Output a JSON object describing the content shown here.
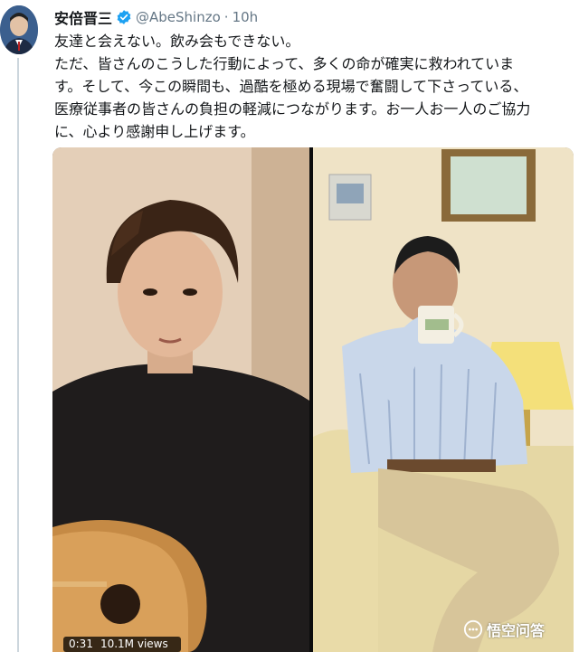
{
  "tweet": {
    "author_name": "安倍晋三",
    "handle": "@AbeShinzo",
    "separator": "·",
    "time": "10h",
    "lines": [
      "友達と会えない。飲み会もできない。",
      "ただ、皆さんのこうした行動によって、多くの命が確実に救われていま",
      "す。そして、今この瞬間も、過酷を極める現場で奮闘して下さっている、",
      "医療従事者の皆さんの負担の軽減につながります。お一人お一人のご協力",
      "に、心より感謝申し上げます。"
    ]
  },
  "media": {
    "duration": "0:31",
    "views": "10.1M views"
  },
  "watermark": {
    "text": "悟空问答"
  },
  "colors": {
    "accent": "#1da1f2",
    "text": "#14171a",
    "muted": "#657786"
  }
}
